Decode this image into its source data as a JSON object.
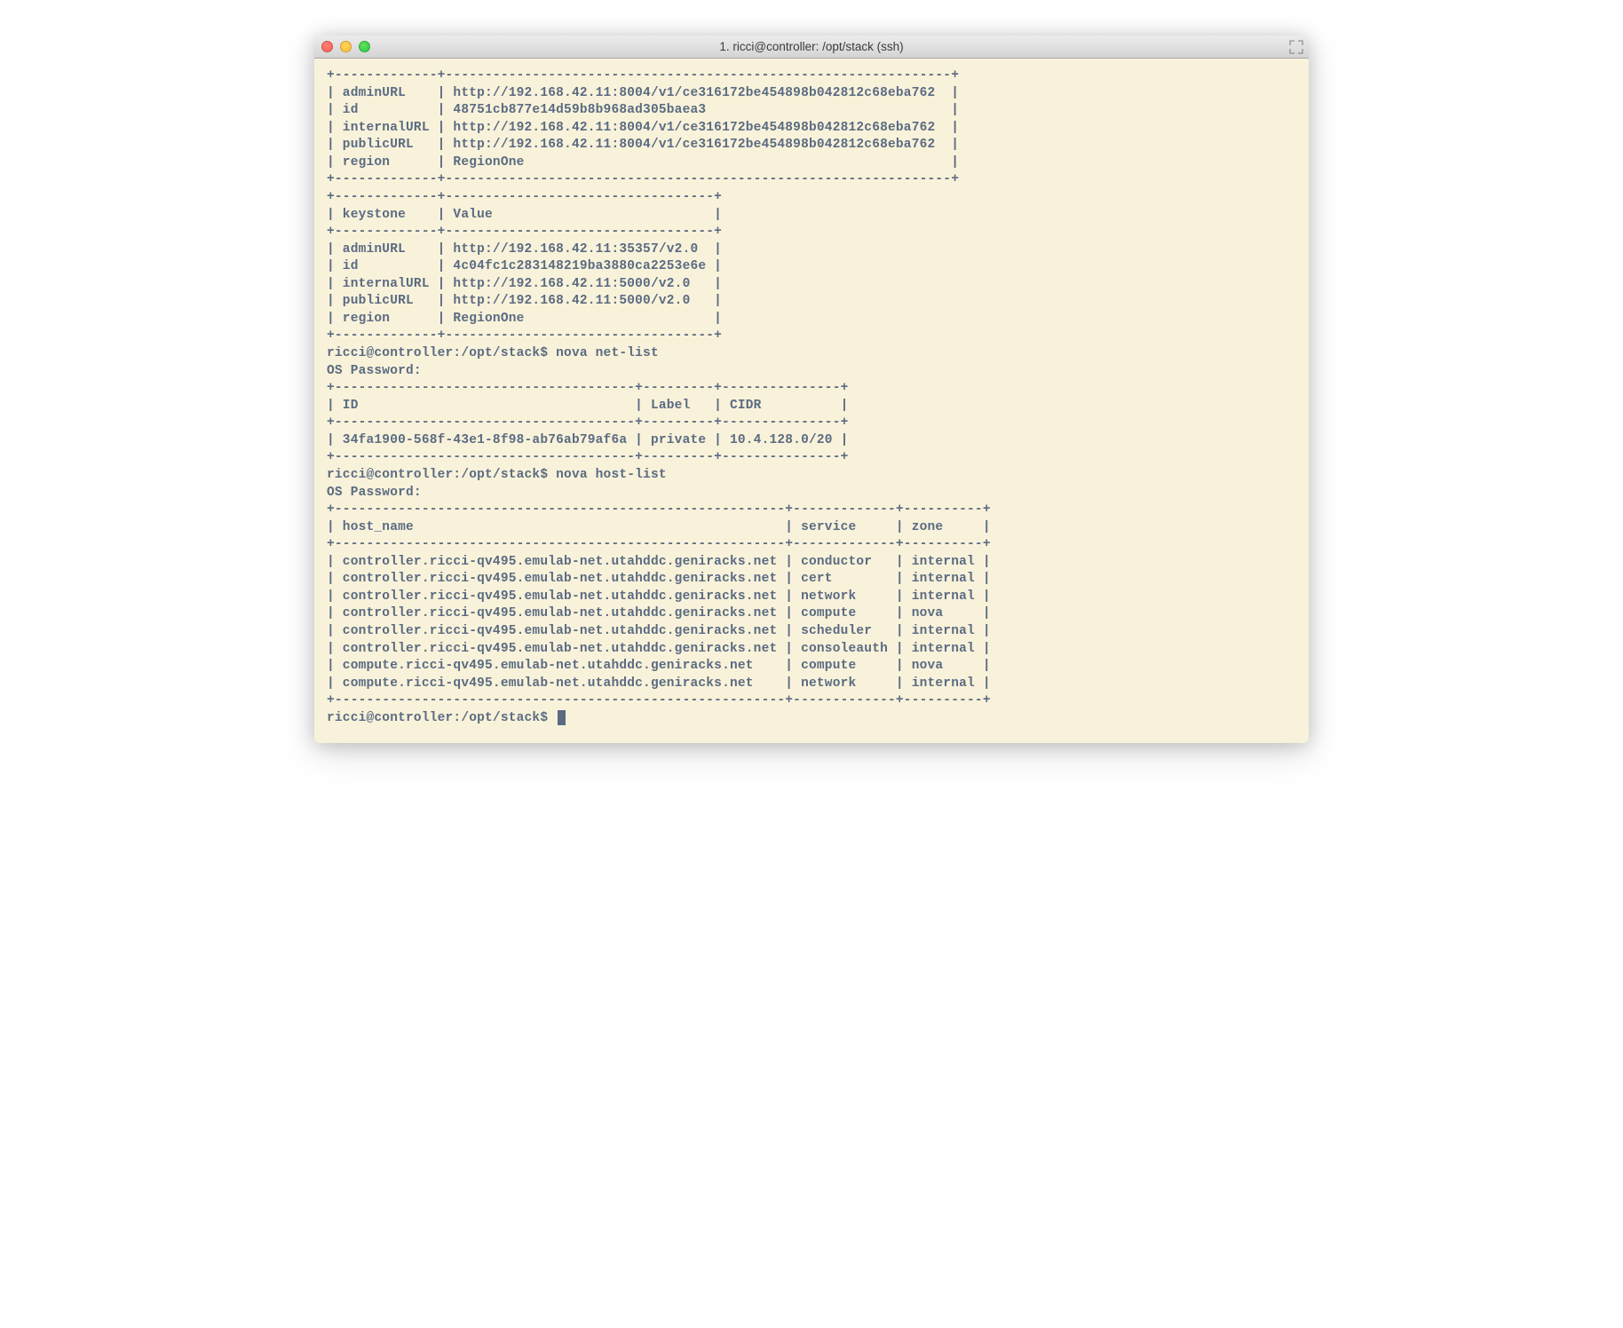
{
  "window": {
    "title": "1. ricci@controller: /opt/stack (ssh)"
  },
  "block1": {
    "border_top": "+-------------+----------------------------------------------------------------+",
    "rows": [
      "| adminURL    | http://192.168.42.11:8004/v1/ce316172be454898b042812c68eba762  |",
      "| id          | 48751cb877e14d59b8b968ad305baea3                               |",
      "| internalURL | http://192.168.42.11:8004/v1/ce316172be454898b042812c68eba762  |",
      "| publicURL   | http://192.168.42.11:8004/v1/ce316172be454898b042812c68eba762  |",
      "| region      | RegionOne                                                      |"
    ],
    "border_bottom": "+-------------+----------------------------------------------------------------+"
  },
  "block2": {
    "border_top": "+-------------+----------------------------------+",
    "header": "| keystone    | Value                            |",
    "sep": "+-------------+----------------------------------+",
    "rows": [
      "| adminURL    | http://192.168.42.11:35357/v2.0  |",
      "| id          | 4c04fc1c283148219ba3880ca2253e6e |",
      "| internalURL | http://192.168.42.11:5000/v2.0   |",
      "| publicURL   | http://192.168.42.11:5000/v2.0   |",
      "| region      | RegionOne                        |"
    ],
    "border_bottom": "+-------------+----------------------------------+"
  },
  "cmd1": {
    "line": "ricci@controller:/opt/stack$ nova net-list",
    "pw": "OS Password: "
  },
  "block3": {
    "border_top": "+--------------------------------------+---------+---------------+",
    "header": "| ID                                   | Label   | CIDR          |",
    "sep": "+--------------------------------------+---------+---------------+",
    "row": "| 34fa1900-568f-43e1-8f98-ab76ab79af6a | private | 10.4.128.0/20 |",
    "border_bottom": "+--------------------------------------+---------+---------------+"
  },
  "cmd2": {
    "line": "ricci@controller:/opt/stack$ nova host-list",
    "pw": "OS Password: "
  },
  "block4": {
    "border_top": "+---------------------------------------------------------+-------------+----------+",
    "header": "| host_name                                               | service     | zone     |",
    "sep": "+---------------------------------------------------------+-------------+----------+",
    "rows": [
      "| controller.ricci-qv495.emulab-net.utahddc.geniracks.net | conductor   | internal |",
      "| controller.ricci-qv495.emulab-net.utahddc.geniracks.net | cert        | internal |",
      "| controller.ricci-qv495.emulab-net.utahddc.geniracks.net | network     | internal |",
      "| controller.ricci-qv495.emulab-net.utahddc.geniracks.net | compute     | nova     |",
      "| controller.ricci-qv495.emulab-net.utahddc.geniracks.net | scheduler   | internal |",
      "| controller.ricci-qv495.emulab-net.utahddc.geniracks.net | consoleauth | internal |",
      "| compute.ricci-qv495.emulab-net.utahddc.geniracks.net    | compute     | nova     |",
      "| compute.ricci-qv495.emulab-net.utahddc.geniracks.net    | network     | internal |"
    ],
    "border_bottom": "+---------------------------------------------------------+-------------+----------+"
  },
  "prompt": "ricci@controller:/opt/stack$ "
}
